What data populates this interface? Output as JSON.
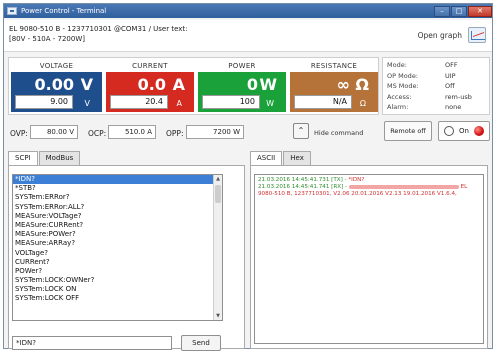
{
  "window": {
    "title": "Power Control - Terminal",
    "minimize": "–",
    "maximize": "□",
    "close": "✕"
  },
  "device": {
    "line1": "EL 9080-510 B - 1237710301 @COM31 / User text:",
    "line2": "[80V - 510A - 7200W]"
  },
  "open_graph_label": "Open graph",
  "meters": {
    "voltage": {
      "label": "VOLTAGE",
      "value": "0.00",
      "unit": "V",
      "set": "9.00",
      "set_unit": "V",
      "color": "#1f4e8c"
    },
    "current": {
      "label": "CURRENT",
      "value": "0.0",
      "unit": "A",
      "set": "20.4",
      "set_unit": "A",
      "color": "#d42a20"
    },
    "power": {
      "label": "POWER",
      "value": "0",
      "unit": "W",
      "set": "100",
      "set_unit": "W",
      "color": "#1aa13a"
    },
    "resistance": {
      "label": "RESISTANCE",
      "value": "∞",
      "unit": "Ω",
      "set": "N/A",
      "set_unit": "Ω",
      "color": "#b5733a"
    }
  },
  "status": [
    {
      "label": "Mode:",
      "value": "OFF"
    },
    {
      "label": "OP Mode:",
      "value": "UIP"
    },
    {
      "label": "MS Mode:",
      "value": "Off"
    },
    {
      "label": "Access:",
      "value": "rem-usb"
    },
    {
      "label": "Alarm:",
      "value": "none"
    }
  ],
  "protection": {
    "ovp_label": "OVP:",
    "ovp_value": "80.00 V",
    "ocp_label": "OCP:",
    "ocp_value": "510.0 A",
    "opp_label": "OPP:",
    "opp_value": "7200 W",
    "hide_label": "Hide command",
    "hide_icon": "⌃",
    "remote_label": "Remote off",
    "on_label": "On"
  },
  "left_tabs": [
    "SCPI",
    "ModBus"
  ],
  "commands": [
    "*IDN?",
    "*STB?",
    "SYSTem:ERRor?",
    "SYSTem:ERRor:ALL?",
    "MEASure:VOLTage?",
    "MEASure:CURRent?",
    "MEASure:POWer?",
    "MEASure:ARRay?",
    "VOLTage?",
    "CURRent?",
    "POWer?",
    "SYSTem:LOCK:OWNer?",
    "SYSTem:LOCK ON",
    "SYSTem:LOCK OFF"
  ],
  "scroll_up": "▲",
  "scroll_down": "▼",
  "command_input": "*IDN?",
  "send_label": "Send",
  "right_tabs": [
    "ASCII",
    "Hex"
  ],
  "log": [
    {
      "time": "21.03.2016  14:45:41.731",
      "dir": "[TX] -",
      "text": "*IDN?"
    },
    {
      "time": "21.03.2016  14:45:41.741",
      "dir": "[RX] -",
      "text": "EL"
    },
    {
      "text": "9080-510 B, 1237710301, V2.06 20.01.2016 V2.13 19.01.2016 V1.6.4,"
    }
  ],
  "colors": {
    "titlebar": "#2f5f9e",
    "selection": "#3b7fd6",
    "led": "#d21010"
  }
}
